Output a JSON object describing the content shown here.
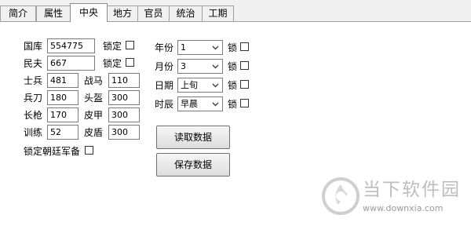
{
  "tabs": [
    "简介",
    "属性",
    "中央",
    "地方",
    "官员",
    "统治",
    "工期"
  ],
  "active_tab": "中央",
  "national_treasury": {
    "label": "国库",
    "value": "554775",
    "lock_label": "锁定"
  },
  "civilians": {
    "label": "民夫",
    "value": "667",
    "lock_label": "锁定"
  },
  "military_left": [
    {
      "label": "士兵",
      "value": "481"
    },
    {
      "label": "兵刀",
      "value": "180"
    },
    {
      "label": "长枪",
      "value": "170"
    },
    {
      "label": "训练",
      "value": "52"
    }
  ],
  "military_right": [
    {
      "label": "战马",
      "value": "110"
    },
    {
      "label": "头盔",
      "value": "300"
    },
    {
      "label": "皮甲",
      "value": "300"
    },
    {
      "label": "皮盾",
      "value": "300"
    }
  ],
  "lock_court_military_label": "锁定朝廷军备",
  "time_settings": [
    {
      "label": "年份",
      "value": "1",
      "lock_label": "锁"
    },
    {
      "label": "月份",
      "value": "3",
      "lock_label": "锁"
    },
    {
      "label": "日期",
      "value": "上旬",
      "lock_label": "锁"
    },
    {
      "label": "时辰",
      "value": "早晨",
      "lock_label": "锁"
    }
  ],
  "buttons": {
    "read": "读取数据",
    "save": "保存数据"
  },
  "watermark": {
    "text": "当下软件园",
    "url": "www.downxia.com"
  },
  "colors": {
    "panel_bg": "#ffffff",
    "window_bg": "#f0f0f0",
    "watermark": "#bdbdbd"
  }
}
